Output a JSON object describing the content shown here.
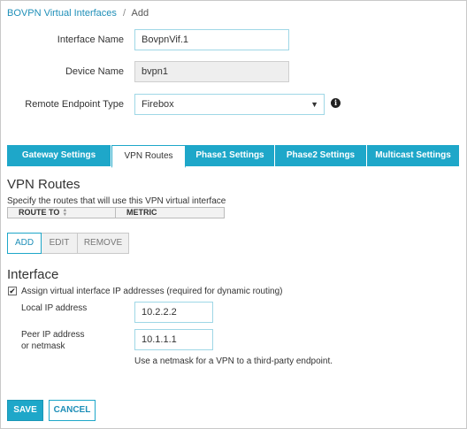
{
  "breadcrumb": {
    "parent": "BOVPN Virtual Interfaces",
    "separator": "/",
    "current": "Add"
  },
  "form": {
    "interface_name_label": "Interface Name",
    "interface_name_value": "BovpnVif.1",
    "device_name_label": "Device Name",
    "device_name_value": "bvpn1",
    "remote_endpoint_label": "Remote Endpoint Type",
    "remote_endpoint_value": "Firebox"
  },
  "tabs": [
    {
      "label": "Gateway Settings",
      "active": false
    },
    {
      "label": "VPN Routes",
      "active": true
    },
    {
      "label": "Phase1 Settings",
      "active": false
    },
    {
      "label": "Phase2 Settings",
      "active": false
    },
    {
      "label": "Multicast Settings",
      "active": false
    }
  ],
  "vpn_routes": {
    "title": "VPN Routes",
    "description": "Specify the routes that will use this VPN virtual interface",
    "columns": [
      "ROUTE TO",
      "METRIC"
    ],
    "buttons": {
      "add": "ADD",
      "edit": "EDIT",
      "remove": "REMOVE"
    }
  },
  "interface": {
    "title": "Interface",
    "assign_checkbox_label": "Assign virtual interface IP addresses (required for dynamic routing)",
    "assign_checked": true,
    "local_ip_label": "Local IP address",
    "local_ip_value": "10.2.2.2",
    "peer_ip_label_line1": "Peer IP address",
    "peer_ip_label_line2": "or netmask",
    "peer_ip_value": "10.1.1.1",
    "hint": "Use a netmask for a VPN to a third-party endpoint."
  },
  "actions": {
    "save": "SAVE",
    "cancel": "CANCEL"
  },
  "colors": {
    "accent": "#1ea7c9",
    "link": "#1f8fb8"
  }
}
